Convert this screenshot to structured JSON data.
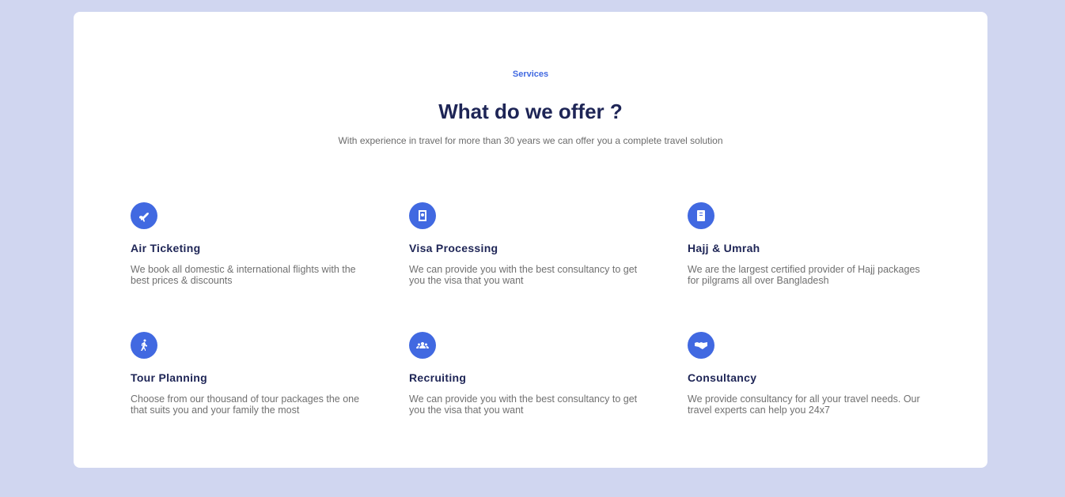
{
  "header": {
    "eyebrow": "Services",
    "title": "What do we offer ?",
    "subtitle": "With experience in travel for more than 30 years we can offer you a complete travel solution"
  },
  "accent_color": "#4169e1",
  "services": [
    {
      "icon": "plane-icon",
      "title": "Air Ticketing",
      "description": "We book all domestic & international flights with the best prices & discounts"
    },
    {
      "icon": "passport-icon",
      "title": "Visa Processing",
      "description": "We can provide you with the best consultancy to get you the visa that you want"
    },
    {
      "icon": "book-icon",
      "title": "Hajj & Umrah",
      "description": "We are the largest certified provider of Hajj packages for pilgrams all over Bangladesh"
    },
    {
      "icon": "walking-icon",
      "title": "Tour Planning",
      "description": "Choose from our thousand of tour packages the one that suits you and your family the most"
    },
    {
      "icon": "users-icon",
      "title": "Recruiting",
      "description": "We can provide you with the best consultancy to get you the visa that you want"
    },
    {
      "icon": "handshake-icon",
      "title": "Consultancy",
      "description": "We provide consultancy for all your travel needs. Our travel experts can help you 24x7"
    }
  ]
}
